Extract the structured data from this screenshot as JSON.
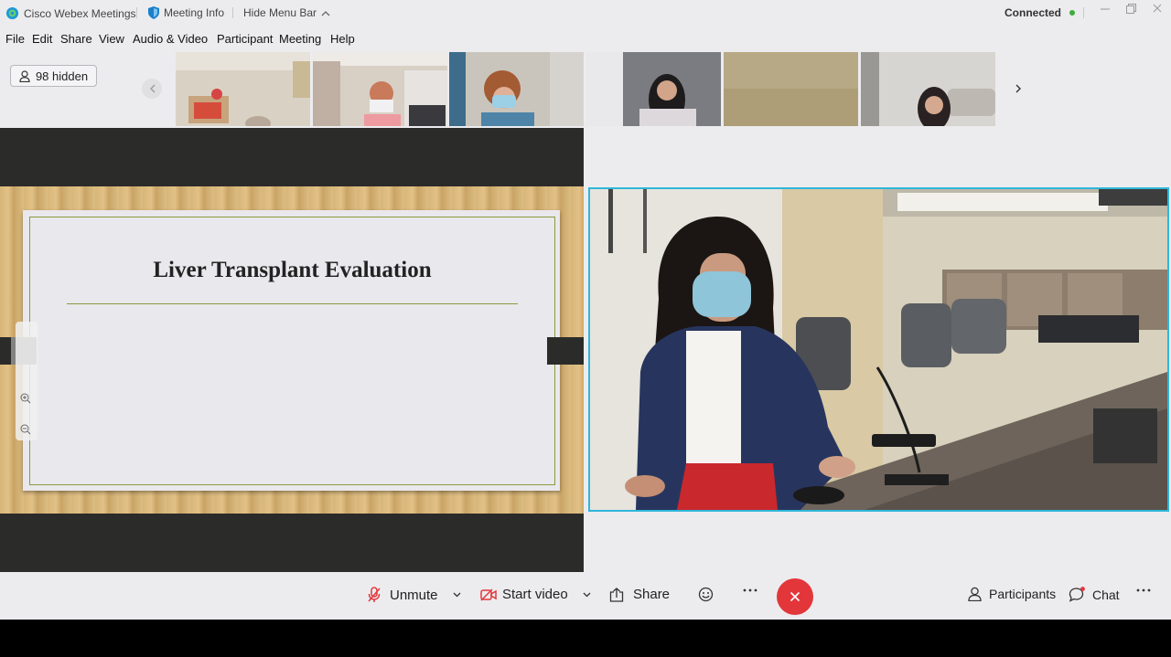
{
  "titlebar": {
    "app_name": "Cisco Webex Meetings",
    "meeting_info": "Meeting Info",
    "hide_menu_bar": "Hide Menu Bar",
    "status": "Connected",
    "status_color": "#3cae3a"
  },
  "menu": [
    "File",
    "Edit",
    "Share",
    "View",
    "Audio & Video",
    "Participant",
    "Meeting",
    "Help"
  ],
  "participants_strip": {
    "hidden_label": "98 hidden",
    "thumbnails": [
      {
        "colors": [
          "#d9d2c4",
          "#cfc5a8"
        ]
      },
      {
        "colors": [
          "#d8cfc5",
          "#b59a86"
        ]
      },
      {
        "colors": [
          "#c9c5bd",
          "#7f8a96"
        ]
      },
      {
        "colors": [
          "#b9b9bd",
          "#5a5a60"
        ]
      },
      {
        "colors": [
          "#b7a985",
          "#b1a37c"
        ]
      },
      {
        "colors": [
          "#d7d5d1",
          "#c0bcb6"
        ]
      }
    ]
  },
  "slide": {
    "title": "Liver Transplant Evaluation"
  },
  "controls": {
    "unmute": "Unmute",
    "start_video": "Start video",
    "share": "Share",
    "participants": "Participants",
    "chat": "Chat",
    "accent_red": "#e3363b"
  }
}
